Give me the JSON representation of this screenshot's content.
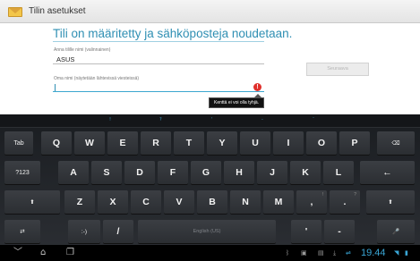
{
  "actionbar": {
    "title": "Tilin asetukset",
    "icon": "envelope-icon"
  },
  "content": {
    "heading": "Tili on määritetty ja sähköposteja noudetaan.",
    "account_label": "Anna tilille nimi (valinnainen)",
    "account_value": "ASUS",
    "name_label": "Oma nimi (näytetään lähtevissä viesteissä)",
    "name_value": "",
    "error_icon": "!",
    "error_tooltip": "Kenttä ei voi olla tyhjä.",
    "next_button": "Seuraava"
  },
  "keyboard": {
    "hints": [
      "!",
      "?",
      "'",
      "-",
      "¨",
      ":",
      "\""
    ],
    "row1": [
      "Tab",
      "Q",
      "W",
      "E",
      "R",
      "T",
      "Y",
      "U",
      "I",
      "O",
      "P",
      "⌫"
    ],
    "row2": [
      "?123",
      "A",
      "S",
      "D",
      "F",
      "G",
      "H",
      "J",
      "K",
      "L",
      "←"
    ],
    "row3": [
      "⬆",
      "Z",
      "X",
      "C",
      "V",
      "B",
      "N",
      "M",
      ",",
      ".",
      "⬆"
    ],
    "row3_subs": {
      "comma": "!",
      "period": "?"
    },
    "row4": {
      "settings": "⇄",
      "smiley": ":-)",
      "slash": "/",
      "space": "English (US)",
      "apostrophe": "'",
      "dash": "-",
      "mic": "🎤"
    }
  },
  "sysbar": {
    "back_icon": "back-icon",
    "home_icon": "home-icon",
    "recent_icon": "recent-apps-icon",
    "time": "19.44",
    "tray_icons": [
      "bluetooth-icon",
      "screenshot-icon",
      "image-icon",
      "download-icon",
      "wifi-icon",
      "battery-icon"
    ]
  },
  "colors": {
    "accent": "#2f8fb3",
    "error": "#e0302c",
    "clock": "#3aa6d6"
  }
}
